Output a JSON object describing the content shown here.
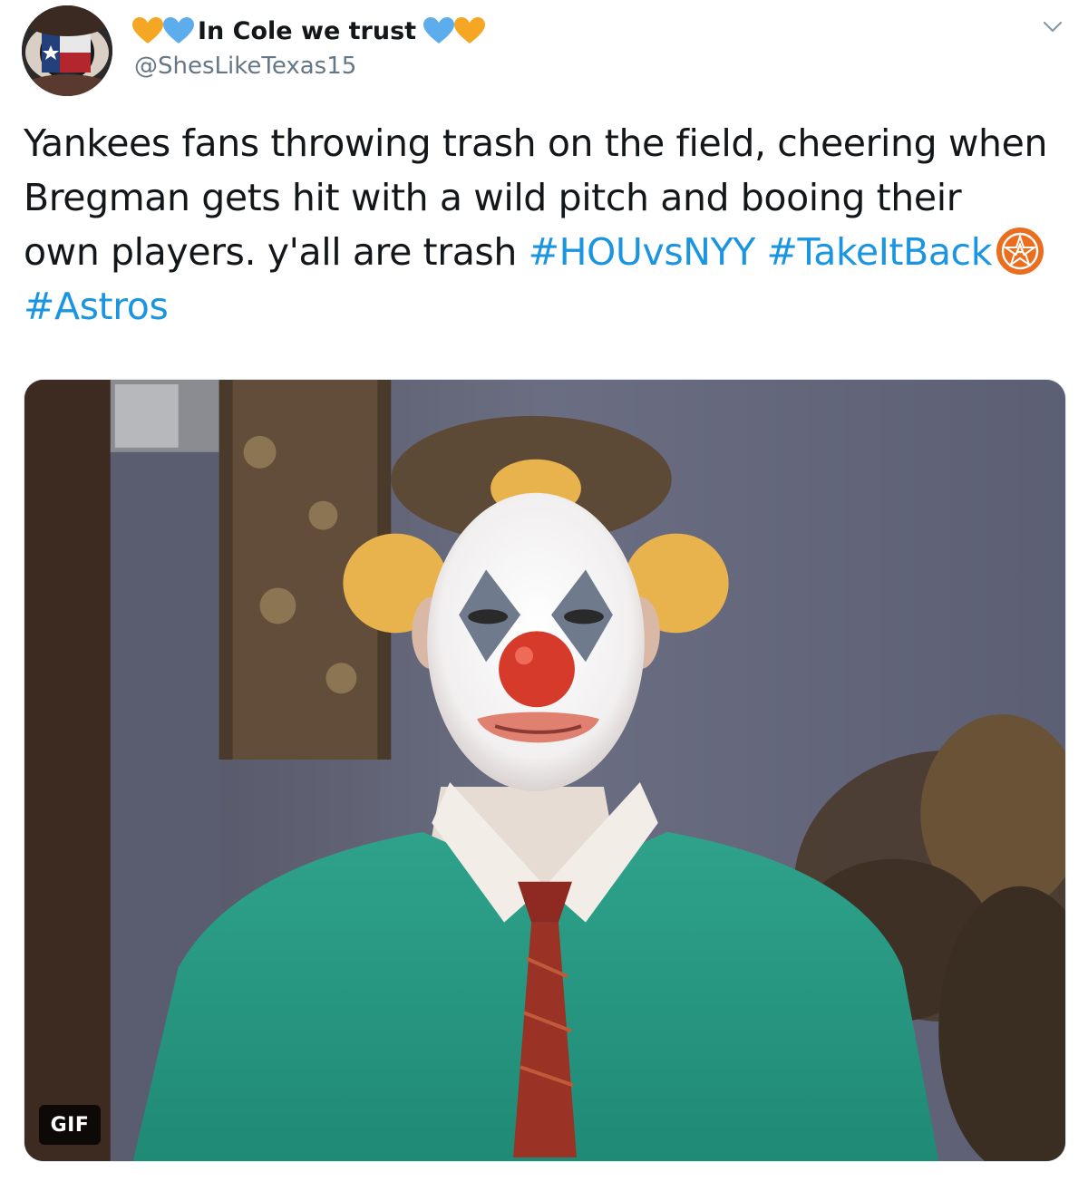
{
  "user": {
    "display_name": "In Cole we trust",
    "handle": "@ShesLikeTexas15",
    "name_emoji_left": [
      "orange-heart",
      "blue-heart"
    ],
    "name_emoji_right": [
      "blue-heart",
      "orange-heart"
    ]
  },
  "tweet": {
    "line1": "Yankees fans throwing trash on the field, cheering when",
    "line2": "Bregman gets hit with a wild pitch and booing their",
    "line3_text": "own players.  y'all are trash ",
    "hashtags": [
      "#HOUvsNYY",
      "#TakeItBack",
      "#Astros"
    ]
  },
  "media": {
    "badge": "GIF"
  },
  "colors": {
    "text": "#14171a",
    "secondary": "#657786",
    "link": "#1b95e0",
    "orange_heart": "#f5a623",
    "blue_heart": "#5dadec",
    "astros_orange": "#eb6e1f"
  }
}
